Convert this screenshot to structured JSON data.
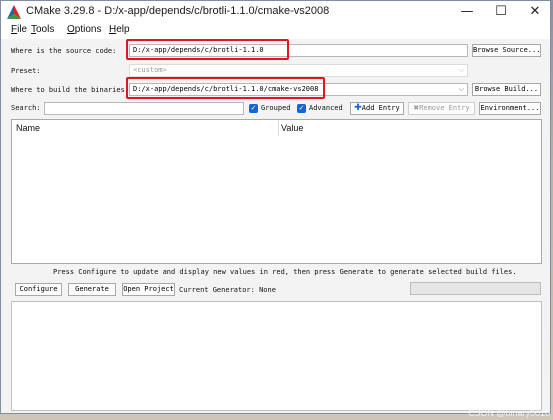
{
  "window": {
    "title": "CMake 3.29.8 - D:/x-app/depends/c/brotli-1.1.0/cmake-vs2008",
    "minimize": "—",
    "maximize": "☐",
    "close": "✕"
  },
  "menu": [
    {
      "label": "File",
      "mnemonic": "F",
      "rest": "ile"
    },
    {
      "label": "Tools",
      "mnemonic": "T",
      "rest": "ools"
    },
    {
      "label": "Options",
      "mnemonic": "O",
      "rest": "ptions"
    },
    {
      "label": "Help",
      "mnemonic": "H",
      "rest": "elp"
    }
  ],
  "source": {
    "label": "Where is the source code:",
    "value": "D:/x-app/depends/c/brotli-1.1.0",
    "browse": "Browse Source..."
  },
  "preset": {
    "label": "Preset:",
    "value": "<custom>"
  },
  "build": {
    "label": "Where to build the binaries:",
    "value": "D:/x-app/depends/c/brotli-1.1.0/cmake-vs2008",
    "browse": "Browse Build..."
  },
  "search": {
    "label": "Search:",
    "value": ""
  },
  "grouped": {
    "label": "Grouped",
    "checked": true
  },
  "advanced": {
    "label": "Advanced",
    "checked": true
  },
  "add_entry": "Add Entry",
  "remove_entry": "Remove Entry",
  "environment": "Environment...",
  "table": {
    "columns": [
      "Name",
      "Value"
    ]
  },
  "hint": "Press Configure to update and display new values in red, then press Generate to generate selected build files.",
  "actions": {
    "configure": "Configure",
    "generate": "Generate",
    "open_project": "Open Project",
    "current_generator": "Current Generator: None"
  },
  "watermark": "CSDN @binary0010",
  "colors": {
    "highlight": "#e3141c",
    "checkbox": "#1565d8"
  }
}
